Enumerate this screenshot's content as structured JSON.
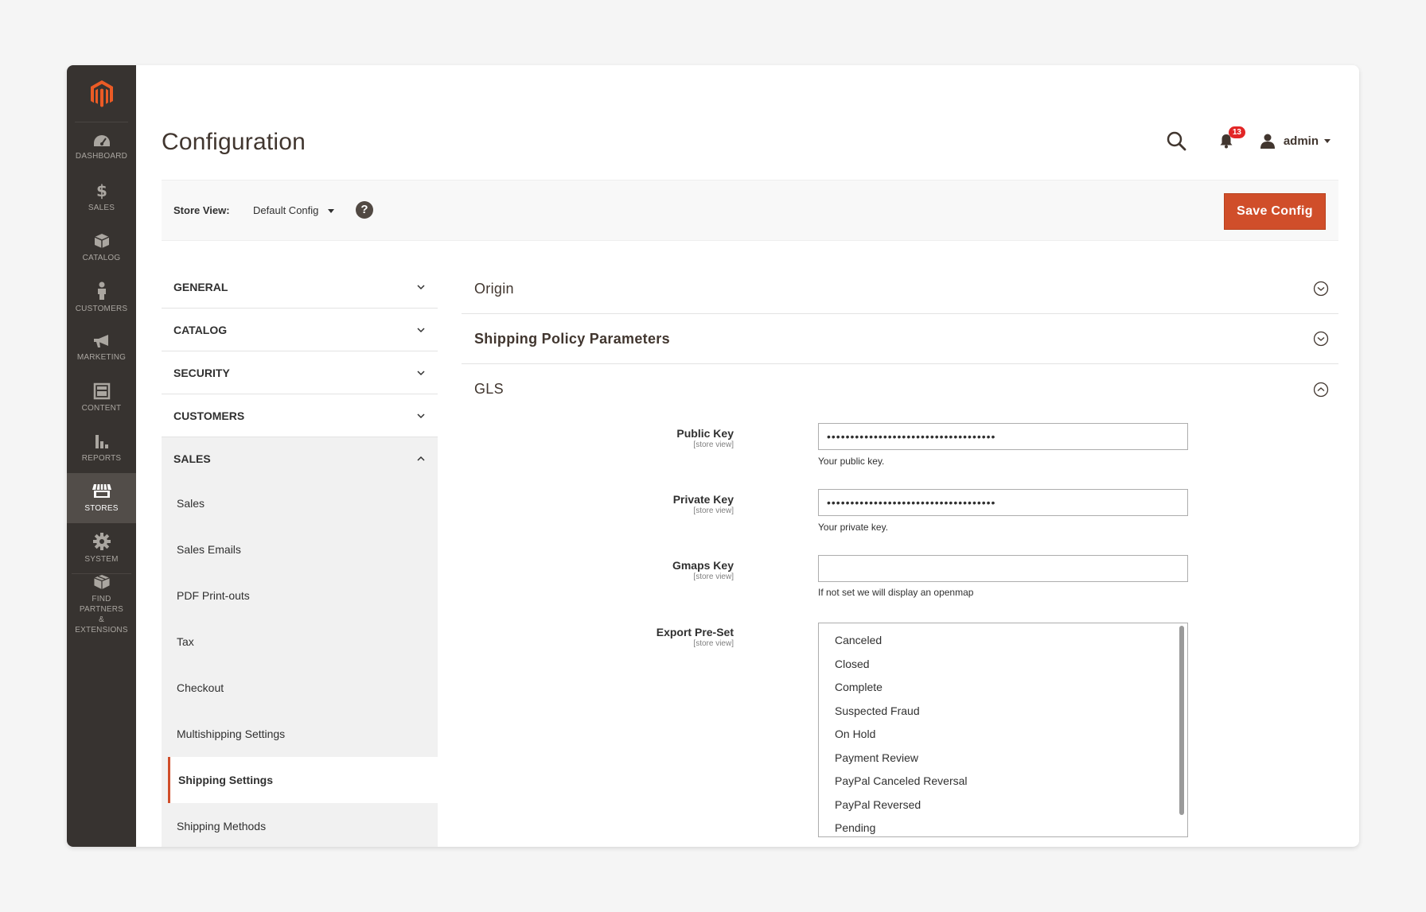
{
  "nav": {
    "items": [
      {
        "label": "DASHBOARD",
        "icon": "dashboard-icon"
      },
      {
        "label": "SALES",
        "icon": "dollar-icon"
      },
      {
        "label": "CATALOG",
        "icon": "cube-icon"
      },
      {
        "label": "CUSTOMERS",
        "icon": "person-icon"
      },
      {
        "label": "MARKETING",
        "icon": "megaphone-icon"
      },
      {
        "label": "CONTENT",
        "icon": "layout-icon"
      },
      {
        "label": "REPORTS",
        "icon": "bar-chart-icon"
      },
      {
        "label": "STORES",
        "icon": "store-icon"
      },
      {
        "label": "SYSTEM",
        "icon": "gear-icon"
      }
    ],
    "partners_line1": "FIND PARTNERS",
    "partners_line2": "& EXTENSIONS",
    "active": "STORES"
  },
  "header": {
    "title": "Configuration",
    "notification_count": "13",
    "user_name": "admin"
  },
  "store_bar": {
    "label": "Store View:",
    "selected": "Default Config",
    "help": "?",
    "save_label": "Save Config"
  },
  "tabs": {
    "groups": [
      "GENERAL",
      "CATALOG",
      "SECURITY",
      "CUSTOMERS",
      "SALES"
    ],
    "sales_items": [
      "Sales",
      "Sales Emails",
      "PDF Print-outs",
      "Tax",
      "Checkout",
      "Multishipping Settings",
      "Shipping Settings",
      "Shipping Methods"
    ],
    "active_item": "Shipping Settings"
  },
  "sections": {
    "origin": "Origin",
    "policy": "Shipping Policy Parameters",
    "gls": "GLS"
  },
  "gls": {
    "public_key": {
      "label": "Public Key",
      "scope": "[store view]",
      "value": "••••••••••••••••••••••••••••••••••••",
      "note": "Your public key."
    },
    "private_key": {
      "label": "Private Key",
      "scope": "[store view]",
      "value": "••••••••••••••••••••••••••••••••••••",
      "note": "Your private key."
    },
    "gmaps_key": {
      "label": "Gmaps Key",
      "scope": "[store view]",
      "value": "",
      "note": "If not set we will display an openmap"
    },
    "export_preset": {
      "label": "Export Pre-Set",
      "scope": "[store view]",
      "options": [
        "Canceled",
        "Closed",
        "Complete",
        "Suspected Fraud",
        "On Hold",
        "Payment Review",
        "PayPal Canceled Reversal",
        "PayPal Reversed",
        "Pending"
      ]
    }
  },
  "colors": {
    "accent": "#d04e2a",
    "nav_bg": "#373330",
    "badge": "#e22626"
  }
}
